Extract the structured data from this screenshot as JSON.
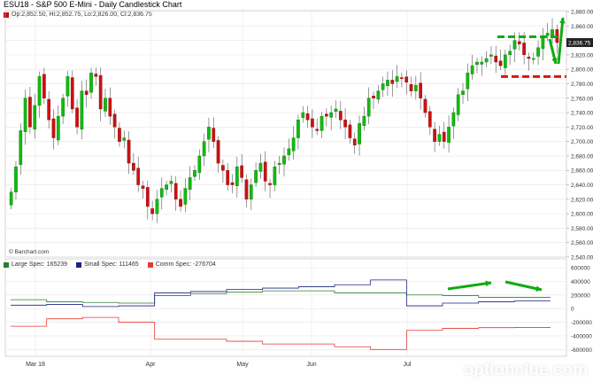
{
  "title": "ESU18 - S&P 500 E-Mini - Daily Candlestick Chart",
  "ohlc_text": "Op:2,852.50, Hi:2,852.75, Lo:2,826.00, Cl:2,836.75",
  "credit": "© Barchart.com",
  "watermark": "optionclue.com",
  "colors": {
    "up": "#11bb11",
    "down": "#cc1111",
    "large": "#2e7d32",
    "small": "#1a237e",
    "comm": "#e53935",
    "grid": "#e6e6e6",
    "dash_green": "#11aa11",
    "dash_red": "#dd1111"
  },
  "chart_data": [
    {
      "type": "candlestick",
      "title": "ESU18 - S&P 500 E-Mini - Daily Candlestick Chart",
      "ylim": [
        2540,
        2880
      ],
      "yticks": [
        "2,880.00",
        "2,860.00",
        "2,840.00",
        "2,820.00",
        "2,800.00",
        "2,780.00",
        "2,760.00",
        "2,740.00",
        "2,720.00",
        "2,700.00",
        "2,680.00",
        "2,660.00",
        "2,640.00",
        "2,620.00",
        "2,600.00",
        "2,580.00",
        "2,560.00",
        "2,540.00"
      ],
      "last_price_label": "2,836.75",
      "x_ticks": [
        "Mar 18",
        "Apr",
        "May",
        "Jun",
        "Jul"
      ],
      "close_path": [
        2630,
        2665,
        2715,
        2760,
        2720,
        2750,
        2790,
        2760,
        2730,
        2705,
        2735,
        2760,
        2790,
        2745,
        2720,
        2770,
        2765,
        2795,
        2790,
        2745,
        2760,
        2735,
        2720,
        2700,
        2705,
        2670,
        2660,
        2640,
        2635,
        2610,
        2600,
        2620,
        2635,
        2640,
        2645,
        2620,
        2610,
        2635,
        2650,
        2660,
        2680,
        2700,
        2720,
        2700,
        2670,
        2660,
        2640,
        2640,
        2665,
        2650,
        2620,
        2640,
        2660,
        2670,
        2645,
        2640,
        2665,
        2670,
        2680,
        2690,
        2705,
        2730,
        2740,
        2730,
        2720,
        2715,
        2735,
        2735,
        2740,
        2745,
        2730,
        2720,
        2705,
        2695,
        2725,
        2735,
        2760,
        2760,
        2770,
        2780,
        2785,
        2780,
        2790,
        2788,
        2782,
        2770,
        2778,
        2760,
        2740,
        2720,
        2700,
        2710,
        2700,
        2720,
        2740,
        2765,
        2770,
        2795,
        2805,
        2810,
        2810,
        2815,
        2820,
        2810,
        2805,
        2820,
        2825,
        2840,
        2835,
        2820,
        2815,
        2815,
        2830,
        2845,
        2850,
        2855,
        2837
      ],
      "annotations": {
        "green_dashed_line_level": 2845,
        "red_dashed_line_level": 2790
      }
    },
    {
      "type": "line",
      "title": "",
      "ylim": [
        -700000,
        600000
      ],
      "yticks": [
        "600000",
        "400000",
        "200000",
        "0",
        "-200000",
        "-400000",
        "-600000"
      ],
      "series": [
        {
          "name": "Large Spec: 165239",
          "values": [
            130000,
            100000,
            90000,
            80000,
            190000,
            220000,
            240000,
            260000,
            260000,
            230000,
            230000,
            200000,
            190000,
            165000,
            165000
          ]
        },
        {
          "name": "Small Spec: 111465",
          "values": [
            50000,
            60000,
            30000,
            40000,
            230000,
            250000,
            280000,
            300000,
            320000,
            350000,
            420000,
            40000,
            80000,
            100000,
            111000
          ]
        },
        {
          "name": "Comm Spec: -276704",
          "values": [
            -260000,
            -150000,
            -130000,
            -200000,
            -450000,
            -450000,
            -480000,
            -520000,
            -520000,
            -560000,
            -600000,
            -320000,
            -290000,
            -280000,
            -276704
          ]
        }
      ]
    }
  ],
  "legend2": [
    {
      "label": "Large Spec: 165239",
      "color": "#2e7d32"
    },
    {
      "label": "Small Spec: 111465",
      "color": "#1a237e"
    },
    {
      "label": "Comm Spec: -276704",
      "color": "#e53935"
    }
  ]
}
